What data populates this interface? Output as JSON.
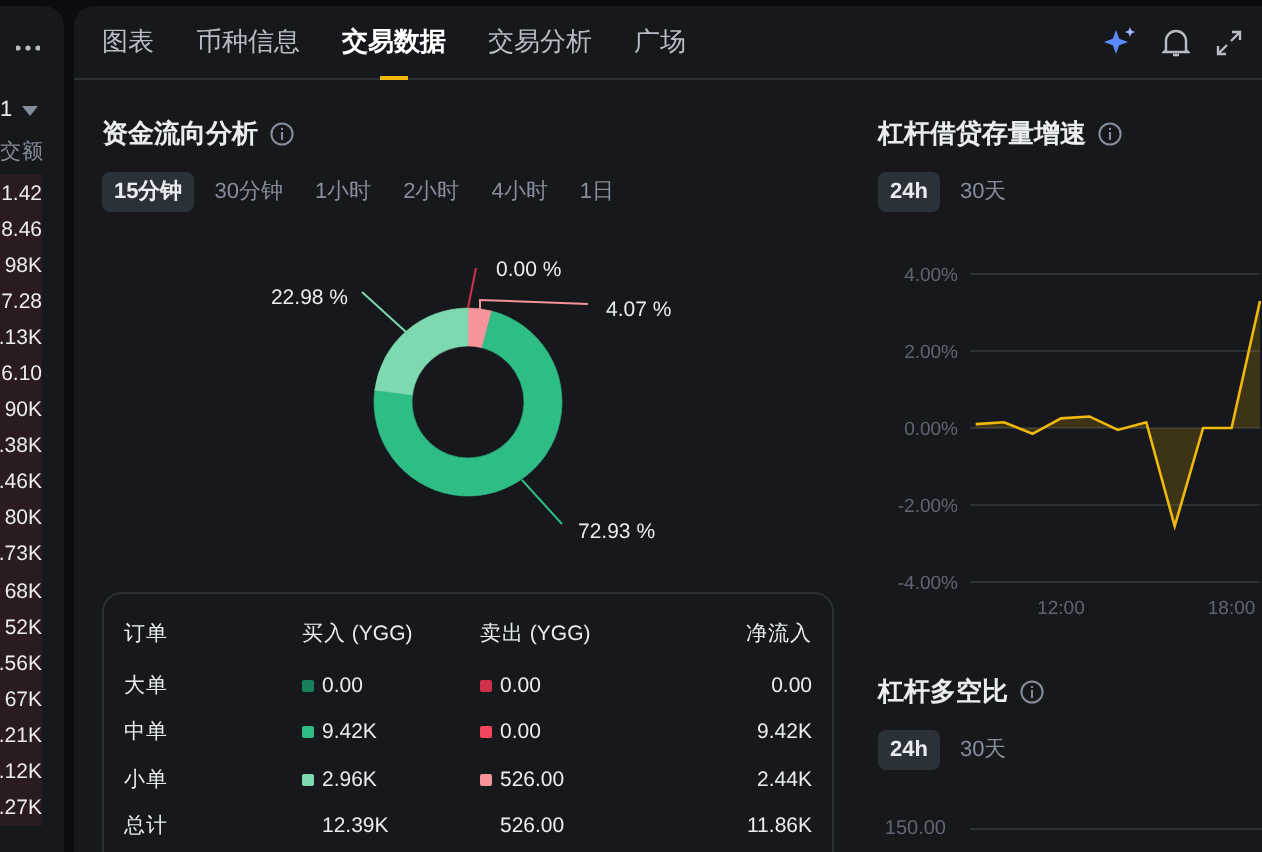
{
  "side_list": {
    "dropdown_value": "1",
    "column_header": "交额",
    "values": [
      "1.42",
      "8.46",
      "98K",
      "7.28",
      ".13K",
      "6.10",
      "90K",
      ".38K",
      ".46K",
      "80K",
      ".73K",
      "68K",
      "52K",
      ".56K",
      "67K",
      ".21K",
      ".12K",
      ".27K"
    ]
  },
  "tabs": [
    {
      "label": "图表",
      "selected": false
    },
    {
      "label": "币种信息",
      "selected": false
    },
    {
      "label": "交易数据",
      "selected": true
    },
    {
      "label": "交易分析",
      "selected": false
    },
    {
      "label": "广场",
      "selected": false
    }
  ],
  "fund_flow": {
    "title": "资金流向分析",
    "periods": [
      {
        "label": "15分钟",
        "selected": true
      },
      {
        "label": "30分钟",
        "selected": false
      },
      {
        "label": "1小时",
        "selected": false
      },
      {
        "label": "2小时",
        "selected": false
      },
      {
        "label": "4小时",
        "selected": false
      },
      {
        "label": "1日",
        "selected": false
      }
    ],
    "chart_data": {
      "type": "donut",
      "values": [
        0.0,
        4.07,
        72.93,
        22.98
      ],
      "colors": [
        "#cf304a",
        "#f7949b",
        "#2ebd85",
        "#7dd9b0"
      ],
      "value_labels": [
        "0.00 %",
        "4.07 %",
        "72.93 %",
        "22.98 %"
      ]
    },
    "table": {
      "columns": [
        "订单",
        "买入 (YGG)",
        "卖出 (YGG)",
        "净流入"
      ],
      "rows": [
        {
          "order": "大单",
          "buy": {
            "value": "0.00",
            "color": "#17805a"
          },
          "sell": {
            "value": "0.00",
            "color": "#cf304a"
          },
          "net": "0.00"
        },
        {
          "order": "中单",
          "buy": {
            "value": "9.42K",
            "color": "#2ebd85"
          },
          "sell": {
            "value": "0.00",
            "color": "#f6465d"
          },
          "net": "9.42K"
        },
        {
          "order": "小单",
          "buy": {
            "value": "2.96K",
            "color": "#7dd9b0"
          },
          "sell": {
            "value": "526.00",
            "color": "#f7949b"
          },
          "net": "2.44K"
        },
        {
          "order": "总计",
          "buy": {
            "value": "12.39K"
          },
          "sell": {
            "value": "526.00"
          },
          "net": "11.86K"
        }
      ]
    }
  },
  "leverage_growth": {
    "title": "杠杆借贷存量增速",
    "periods": [
      {
        "label": "24h",
        "selected": true
      },
      {
        "label": "30天",
        "selected": false
      }
    ],
    "chart_data": {
      "type": "area",
      "grid": true,
      "x": [
        9,
        10,
        11,
        12,
        13,
        14,
        15,
        16,
        17,
        18,
        19
      ],
      "series": [
        {
          "color": "#f0b90b",
          "values": [
            0.1,
            0.15,
            -0.15,
            0.25,
            0.3,
            -0.05,
            0.15,
            -2.55,
            0.0,
            0.0,
            3.3
          ]
        }
      ],
      "xlim": [
        8.8,
        19
      ],
      "ylim": [
        -4,
        4
      ],
      "yticks": [
        {
          "value": 4,
          "label": "4.00%"
        },
        {
          "value": 2,
          "label": "2.00%"
        },
        {
          "value": 0,
          "label": "0.00%"
        },
        {
          "value": -2,
          "label": "-2.00%"
        },
        {
          "value": -4,
          "label": "-4.00%"
        }
      ],
      "xticks": [
        {
          "value": 12,
          "label": "12:00"
        },
        {
          "value": 18,
          "label": "18:00"
        }
      ]
    }
  },
  "leverage_ratio": {
    "title": "杠杆多空比",
    "periods": [
      {
        "label": "24h",
        "selected": true
      },
      {
        "label": "30天",
        "selected": false
      }
    ],
    "y_tick_label": "150.00"
  }
}
